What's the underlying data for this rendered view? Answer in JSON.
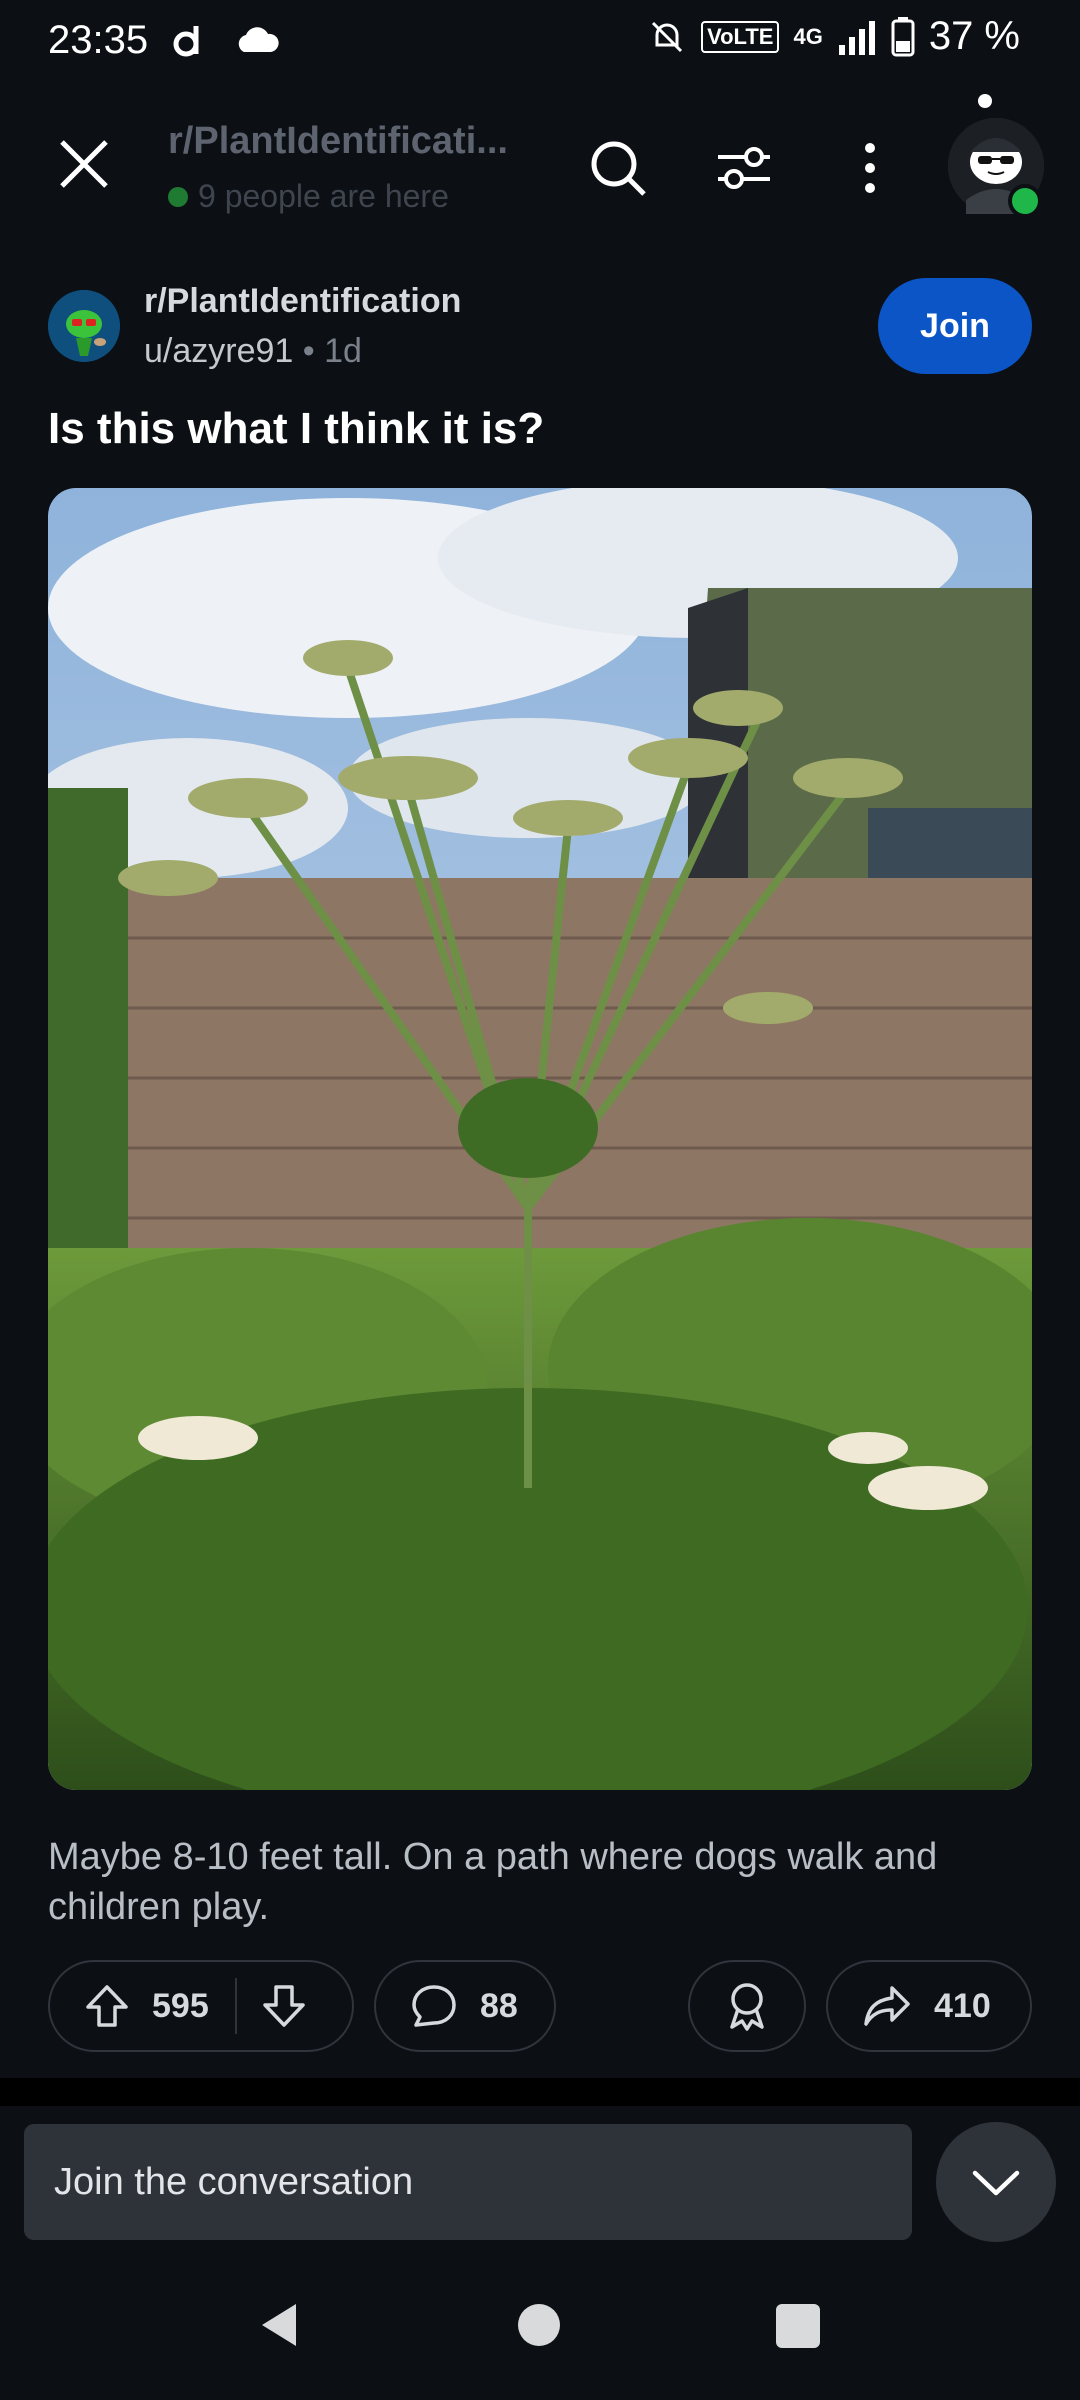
{
  "status_bar": {
    "time": "23:35",
    "network": "4G",
    "volte": "VoLTE",
    "battery": "37 %"
  },
  "header": {
    "title": "r/PlantIdentificati...",
    "presence": "9 people are here"
  },
  "post": {
    "subreddit": "r/PlantIdentification",
    "author": "u/azyre91",
    "age": "1d",
    "join_label": "Join",
    "title": "Is this what I think it is?",
    "body": "Maybe 8-10 feet tall. On a path where dogs walk and children play."
  },
  "actions": {
    "upvotes": "595",
    "comments": "88",
    "shares": "410"
  },
  "composer": {
    "placeholder": "Join the conversation"
  },
  "icons": [
    "close-icon",
    "search-icon",
    "filter-icon",
    "more-icon",
    "upvote-icon",
    "downvote-icon",
    "comment-icon",
    "award-icon",
    "share-icon",
    "chevron-down-icon"
  ],
  "colors": {
    "background": "#0c1015",
    "join_button": "#0b55c7",
    "online": "#1fb74a"
  }
}
